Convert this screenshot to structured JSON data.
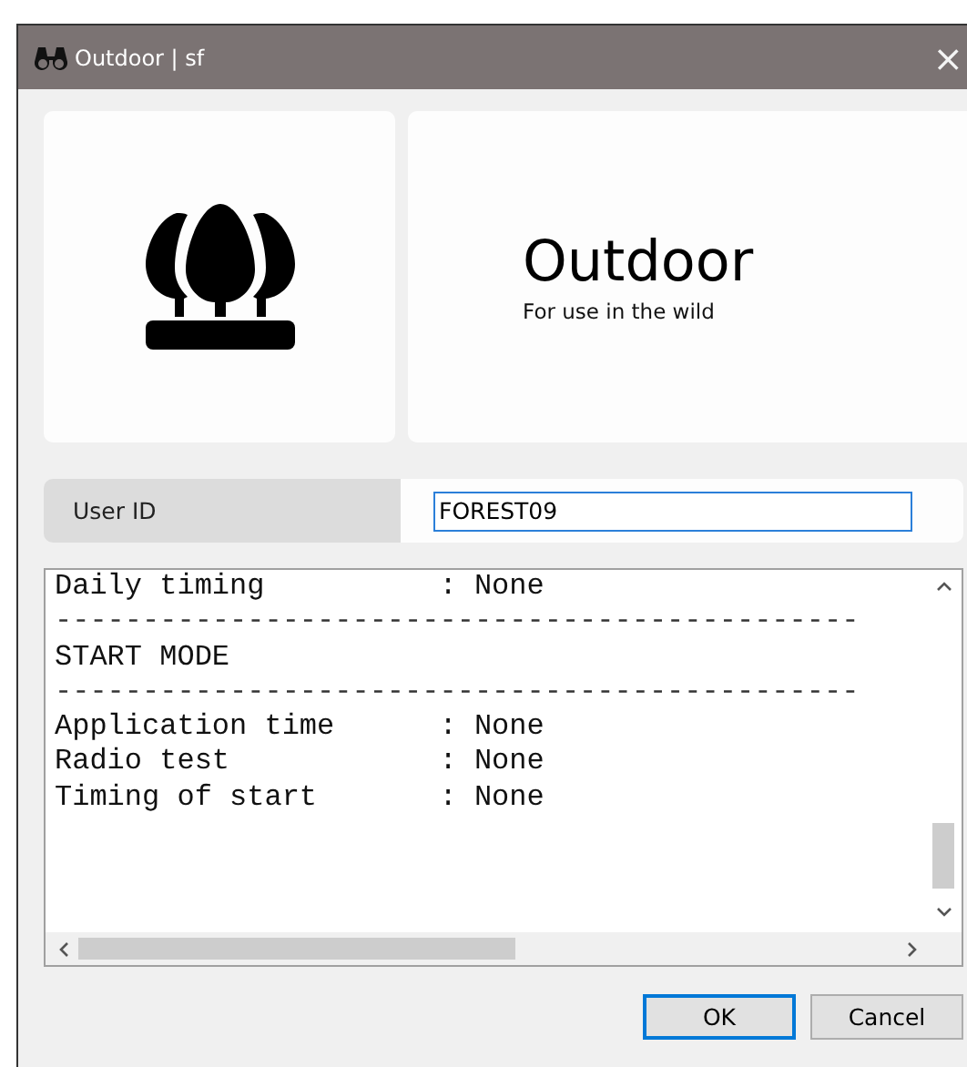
{
  "window": {
    "title": "Outdoor | sf",
    "close": "×"
  },
  "card": {
    "title": "Outdoor",
    "subtitle": "For use in the wild"
  },
  "user_id": {
    "label": "User ID",
    "value": "FOREST09"
  },
  "log": [
    {
      "kind": "text",
      "text": "Daily timing          : None"
    },
    {
      "kind": "rule",
      "text": "----------------------------------------------"
    },
    {
      "kind": "text",
      "text": "START MODE"
    },
    {
      "kind": "rule",
      "text": "----------------------------------------------"
    },
    {
      "kind": "text",
      "text": "Application time      : None"
    },
    {
      "kind": "text",
      "text": "Radio test            : None"
    },
    {
      "kind": "text",
      "text": "Timing of start       : None"
    }
  ],
  "buttons": [
    {
      "label": "OK",
      "default": true
    },
    {
      "label": "Cancel",
      "default": false
    }
  ]
}
